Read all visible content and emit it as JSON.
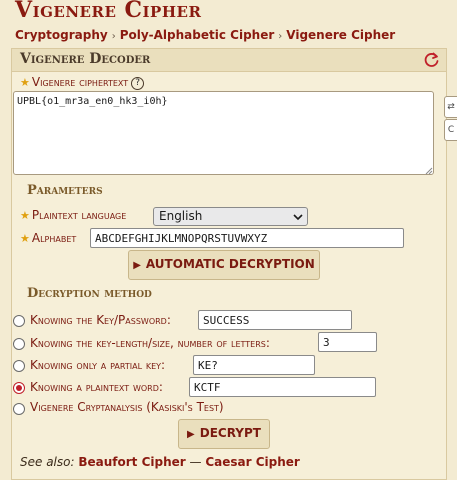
{
  "title": "Vigenere Cipher",
  "breadcrumb": [
    "Cryptography",
    "Poly-Alphabetic Cipher",
    "Vigenere Cipher"
  ],
  "panel": {
    "title": "Vigenere Decoder",
    "reset_icon": "refresh-icon",
    "ciphertext_label": "Vigenere ciphertext",
    "help_symbol": "?",
    "ciphertext_value": "UPBL{o1_mr3a_en0_hk3_i0h}",
    "side_tab_glyphs": [
      "⇄",
      "C"
    ]
  },
  "parameters": {
    "heading": "Parameters",
    "language_label": "Plaintext language",
    "language_value": "English",
    "alphabet_label": "Alphabet",
    "alphabet_value": "ABCDEFGHIJKLMNOPQRSTUVWXYZ",
    "auto_button": "AUTOMATIC DECRYPTION"
  },
  "method": {
    "heading": "Decryption method",
    "options": [
      {
        "label": "Knowing the Key/Password:",
        "value": "SUCCESS",
        "checked": false
      },
      {
        "label": "Knowing the key-length/size, number of letters:",
        "value": "3",
        "checked": false
      },
      {
        "label": "Knowing only a partial key:",
        "value": "KE?",
        "checked": false
      },
      {
        "label": "Knowing a plaintext word:",
        "value": "KCTF",
        "checked": true
      },
      {
        "label": "Vigenere Cryptanalysis (Kasiski's Test)",
        "value": "",
        "checked": false
      }
    ],
    "decrypt_button": "DECRYPT"
  },
  "see_also": {
    "label": "See also:",
    "links": [
      "Beaufort Cipher",
      "Caesar Cipher"
    ],
    "separator": "—"
  },
  "colors": {
    "background": "#f3ebd2",
    "accent": "#8a1a10",
    "star": "#e0a010",
    "radio_checked": "#c0202a"
  }
}
